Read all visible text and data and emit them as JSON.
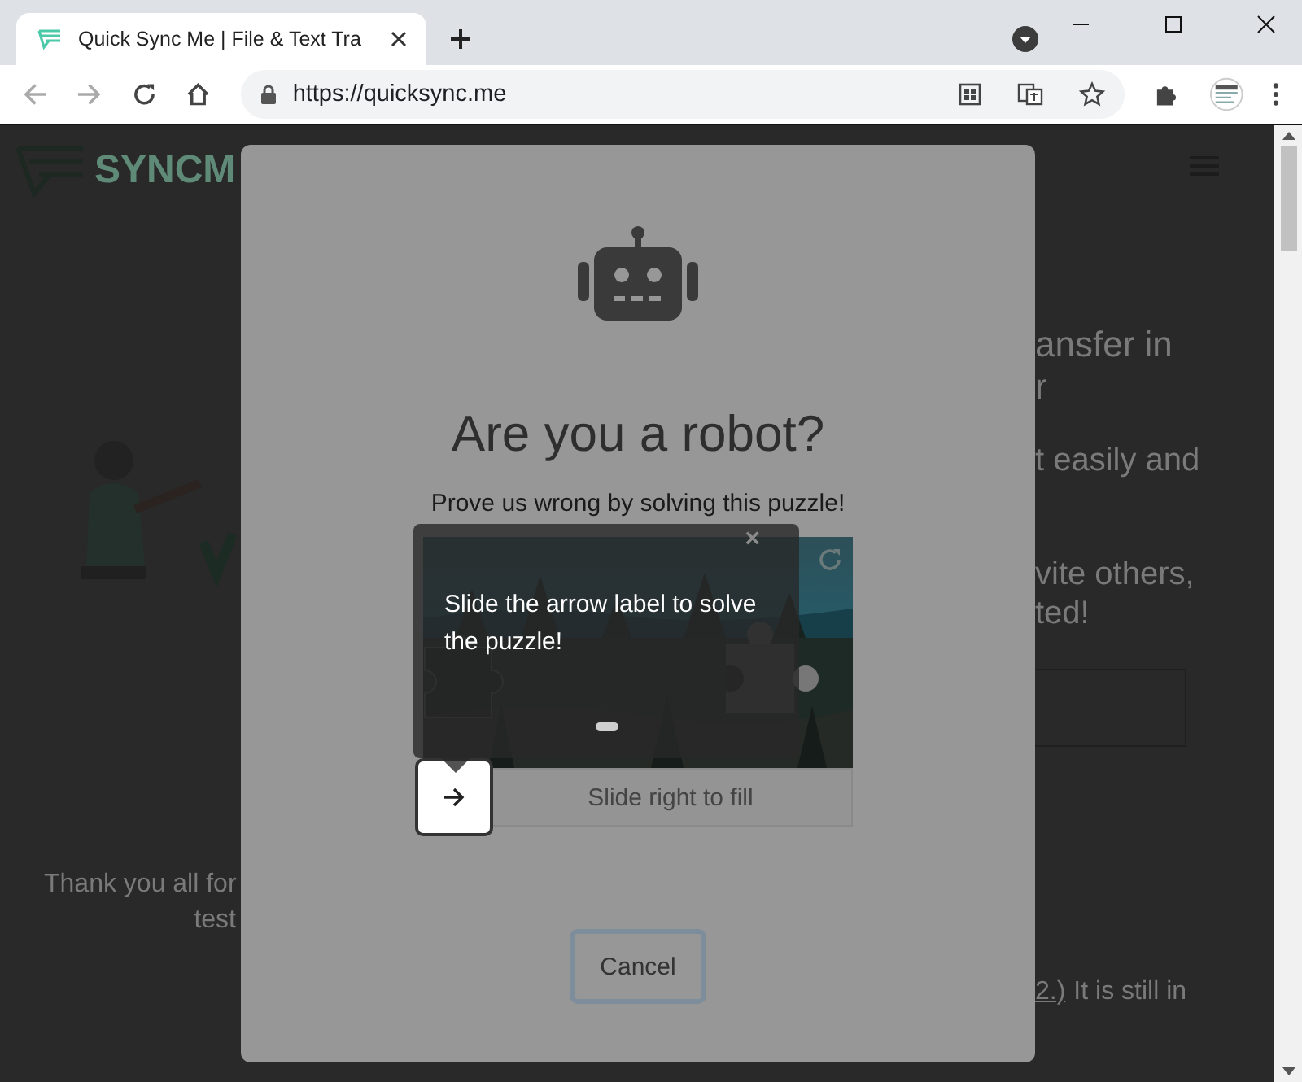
{
  "browser": {
    "tab": {
      "title": "Quick Sync Me | File & Text Tra",
      "selected": true
    },
    "address": "https://quicksync.me"
  },
  "background_page": {
    "logo_text": "SYNCM",
    "hero_title_lines": [
      "ansfer in",
      "r"
    ],
    "hero_text_lines": [
      "t easily and",
      "vite others,",
      "ted!"
    ],
    "footer_left": [
      "Thank you all for",
      "test"
    ],
    "footer_right": {
      "link": "2.)",
      "text": "It is still in"
    }
  },
  "dialog": {
    "title": "Are you a robot?",
    "subtitle": "Prove us wrong by solving this puzzle!",
    "slider": {
      "hint": "Slide right to fill",
      "level": 0
    },
    "cancel": "Cancel"
  },
  "tooltip": {
    "close": "×",
    "text": "Slide the arrow label to solve the puzzle!"
  }
}
